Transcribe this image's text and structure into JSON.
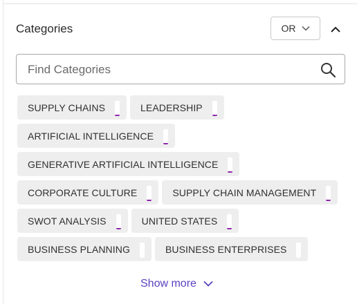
{
  "filter": {
    "title": "Categories",
    "operator_label": "OR",
    "search_placeholder": "Find Categories",
    "chips": [
      {
        "label": "SUPPLY CHAINS",
        "underline": true
      },
      {
        "label": "LEADERSHIP",
        "underline": true
      },
      {
        "label": "ARTIFICIAL INTELLIGENCE",
        "underline": true
      },
      {
        "label": "GENERATIVE ARTIFICIAL INTELLIGENCE",
        "underline": true
      },
      {
        "label": "CORPORATE CULTURE",
        "underline": true
      },
      {
        "label": "SUPPLY CHAIN MANAGEMENT",
        "underline": true
      },
      {
        "label": "SWOT ANALYSIS",
        "underline": true
      },
      {
        "label": "UNITED STATES",
        "underline": true
      },
      {
        "label": "BUSINESS PLANNING",
        "underline": false
      },
      {
        "label": "BUSINESS ENTERPRISES",
        "underline": false
      }
    ],
    "show_more_label": "Show more"
  },
  "colors": {
    "accent": "#5a3fc0",
    "chip_bg": "#eeeeee",
    "chip_marker": "#8e24aa"
  },
  "icons": {
    "operator_dropdown": "chevron-down-icon",
    "collapse": "chevron-up-icon",
    "search": "search-icon",
    "show_more": "chevron-down-icon"
  }
}
